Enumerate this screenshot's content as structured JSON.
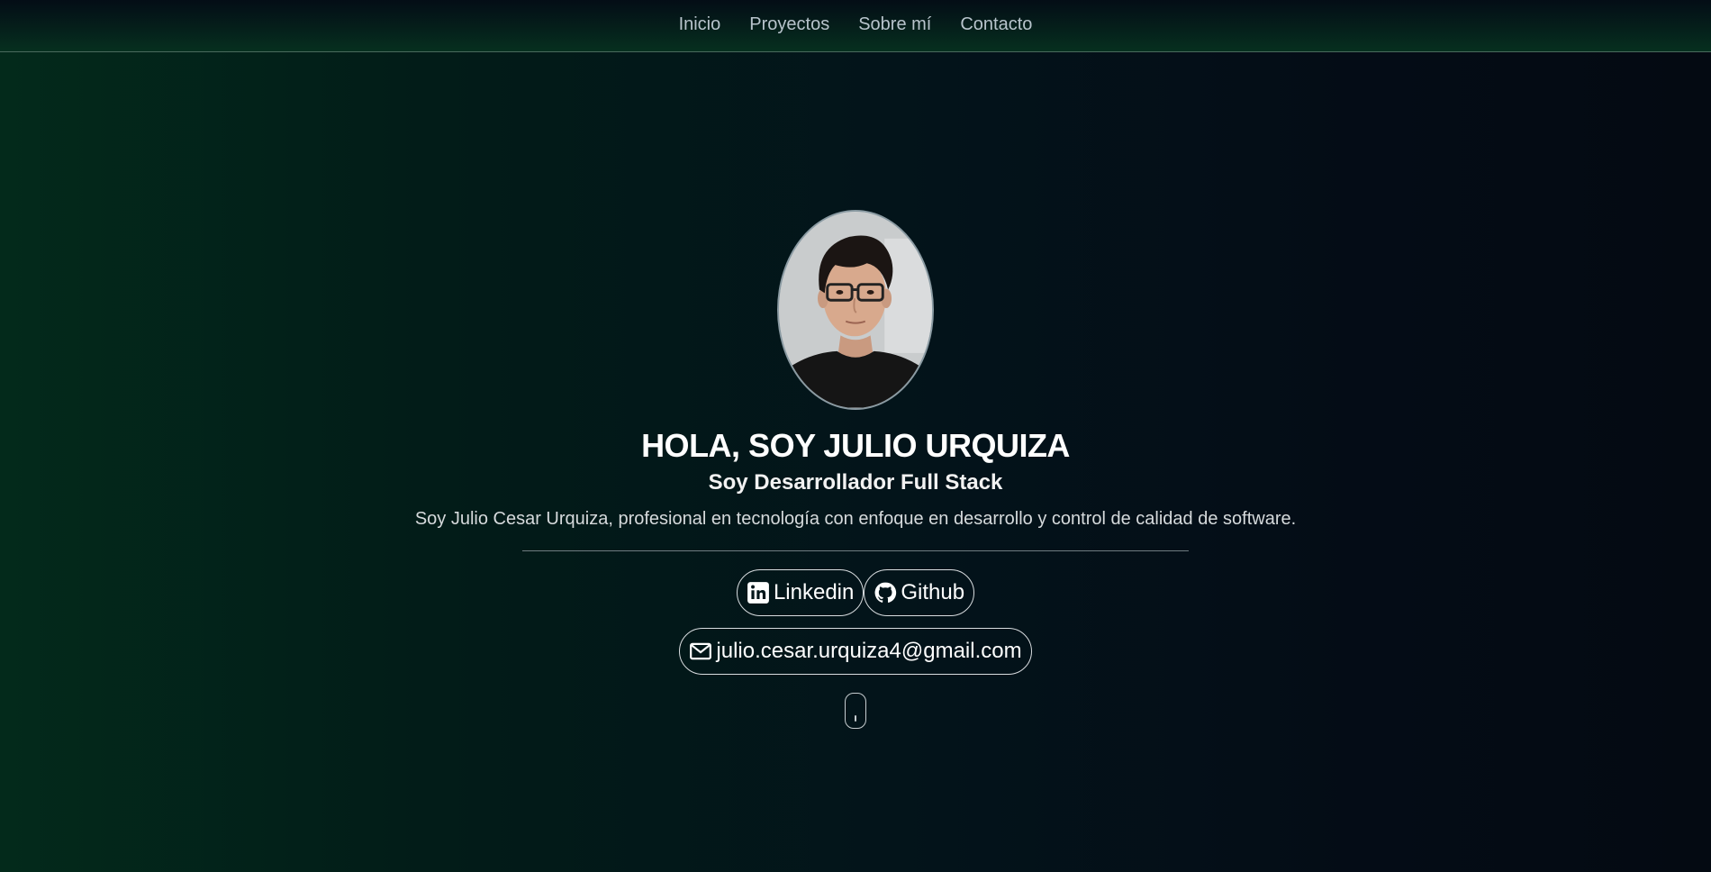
{
  "nav": {
    "items": [
      {
        "label": "Inicio"
      },
      {
        "label": "Proyectos"
      },
      {
        "label": "Sobre mí"
      },
      {
        "label": "Contacto"
      }
    ]
  },
  "hero": {
    "title": "HOLA, SOY JULIO URQUIZA",
    "subtitle": "Soy Desarrollador Full Stack",
    "description": "Soy Julio Cesar Urquiza, profesional en tecnología con enfoque en desarrollo y control de calidad de software.",
    "links": {
      "linkedin": {
        "label": "Linkedin",
        "icon": "linkedin-icon"
      },
      "github": {
        "label": "Github",
        "icon": "github-icon"
      },
      "email": {
        "label": "julio.cesar.urquiza4@gmail.com",
        "icon": "mail-icon"
      }
    }
  },
  "colors": {
    "background_left": "#032a1b",
    "background_right": "#040a12",
    "nav_text": "#b8c4cc",
    "accent_border": "#d9dde0"
  }
}
